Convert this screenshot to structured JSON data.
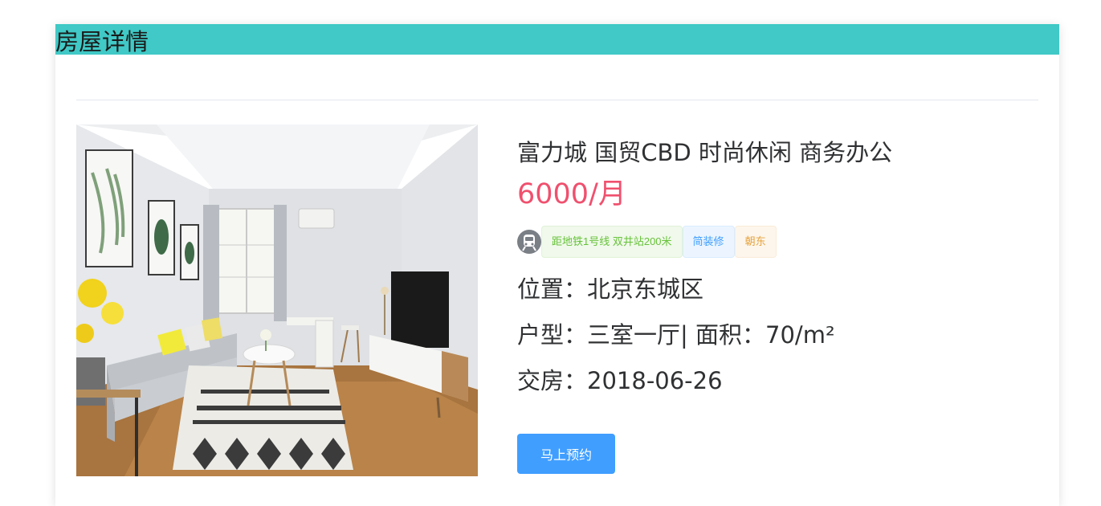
{
  "card": {
    "title": "房屋详情"
  },
  "house": {
    "title": "富力城 国贸CBD 时尚休闲 商务办公",
    "price": "6000/月",
    "tags": [
      {
        "label": "距地铁1号线 双井站200米",
        "style": "success"
      },
      {
        "label": "简装修",
        "style": "primary"
      },
      {
        "label": "朝东",
        "style": "warning"
      }
    ],
    "location_label": "位置：",
    "location_value": "北京东城区",
    "layout_label": "户型：",
    "layout_value": "三室一厅",
    "area_label": "| 面积：",
    "area_value": "70/m²",
    "handover_label": "交房：",
    "handover_value": "2018-06-26"
  },
  "actions": {
    "book_label": "马上预约"
  },
  "colors": {
    "header": "#40c9c6",
    "price": "#f0506e",
    "button": "#409eff",
    "tag_success": "#67c23a",
    "tag_primary": "#409eff",
    "tag_warning": "#e6a23c"
  },
  "icons": {
    "subway": "subway-icon",
    "photo": "living-room-photo"
  }
}
